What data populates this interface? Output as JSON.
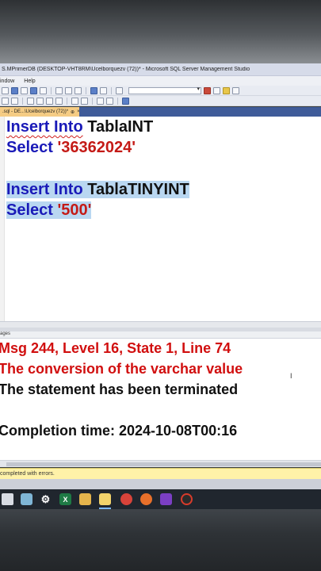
{
  "window": {
    "title": "S.MPrimerDB (DESKTOP-VHT8RM\\Ucelborquezv (72))* - Microsoft SQL Server Management Studio"
  },
  "menu": {
    "items": [
      "indow",
      "Help"
    ]
  },
  "tabs": {
    "doc_label": ".sql - DE...\\Ucelborquezv (72))*",
    "pin_icon": "pin-icon",
    "close_icon": "close-icon"
  },
  "editor": {
    "lines": [
      {
        "kw": "Insert Into",
        "ident": "TablaINT"
      },
      {
        "kw": "Select",
        "str": "'36362024'"
      },
      {
        "kw": "Insert Into",
        "ident": "TablaTINYINT"
      },
      {
        "kw": "Select",
        "str": "'500'"
      }
    ]
  },
  "messages": {
    "tab_label": "ages",
    "lines": [
      "Msg 244, Level 16, State 1, Line 74",
      "The conversion of the varchar value",
      "The statement has been terminated",
      "Completion time: 2024-10-08T00:16"
    ]
  },
  "status": {
    "text": "completed with errors."
  },
  "taskbar": {
    "icons": [
      "windows-icon",
      "explorer-icon",
      "settings-icon",
      "excel-icon",
      "folder-icon",
      "ssms-icon",
      "chrome-icon",
      "firefox-icon",
      "files-icon",
      "recorder-icon"
    ],
    "excel_letter": "X"
  },
  "colors": {
    "keyword": "#1a1ab8",
    "string": "#c41a16",
    "error": "#d10f0f",
    "selection": "#b9d7f1",
    "tab_active": "#f5cc84",
    "status_bar": "#fff2a8"
  }
}
